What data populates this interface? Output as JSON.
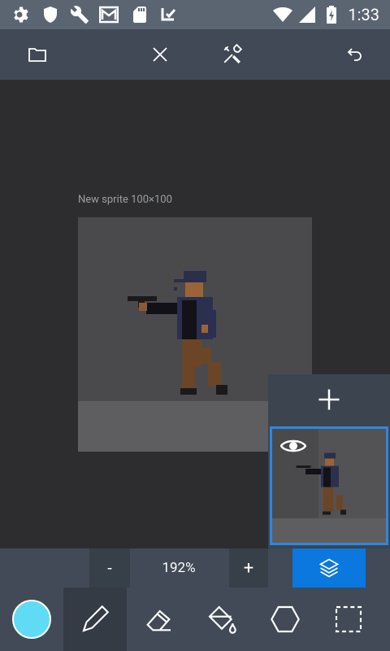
{
  "status_bar": {
    "time": "1:33"
  },
  "canvas": {
    "sprite_label": "New sprite 100×100"
  },
  "zoom": {
    "minus": "-",
    "value": "192%",
    "plus": "+"
  },
  "colors": {
    "primary": "#5fdbf5",
    "accent": "#0b78df"
  },
  "icons": {
    "status": [
      "settings-icon",
      "shield-icon",
      "wrench-icon",
      "mail-icon",
      "sd-card-icon",
      "task-icon",
      "wifi-icon",
      "signal-icon",
      "battery-icon"
    ],
    "toolbar": [
      "folder-icon",
      "close-icon",
      "tools-icon",
      "undo-icon"
    ],
    "tools": [
      "pencil-icon",
      "eraser-icon",
      "bucket-icon",
      "hexagon-icon",
      "selection-icon"
    ]
  }
}
